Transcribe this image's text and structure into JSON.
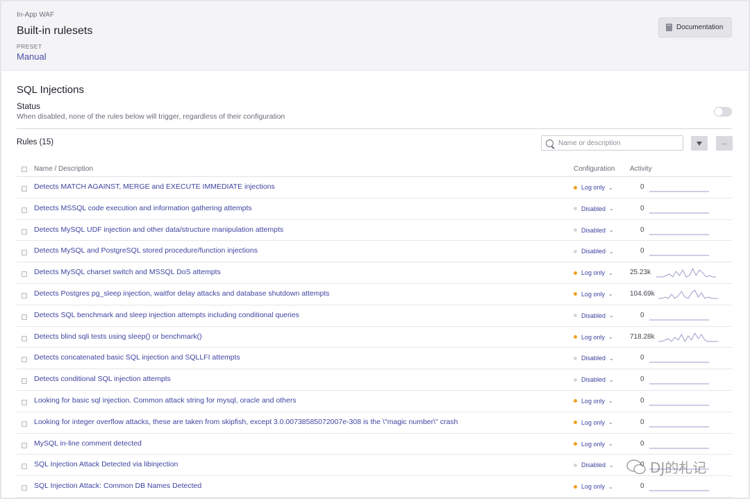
{
  "header": {
    "breadcrumb": "In-App WAF",
    "title": "Built-in rulesets",
    "preset_label": "PRESET",
    "preset_value": "Manual",
    "doc_button": "Documentation"
  },
  "section": {
    "title": "SQL Injections",
    "status_label": "Status",
    "status_desc": "When disabled, none of the rules below will trigger, regardless of their configuration",
    "enabled": false
  },
  "rules": {
    "title": "Rules (15)",
    "search_placeholder": "Name or description",
    "more_label": "···",
    "columns": {
      "name": "Name / Description",
      "config": "Configuration",
      "activity": "Activity"
    },
    "items": [
      {
        "name": "Detects MATCH AGAINST, MERGE and EXECUTE IMMEDIATE injections",
        "config": "Log only",
        "activity": "0"
      },
      {
        "name": "Detects MSSQL code execution and information gathering attempts",
        "config": "Disabled",
        "activity": "0"
      },
      {
        "name": "Detects MySQL UDF injection and other data/structure manipulation attempts",
        "config": "Disabled",
        "activity": "0"
      },
      {
        "name": "Detects MySQL and PostgreSQL stored procedure/function injections",
        "config": "Disabled",
        "activity": "0"
      },
      {
        "name": "Detects MySQL charset switch and MSSQL DoS attempts",
        "config": "Log only",
        "activity": "25.23k"
      },
      {
        "name": "Detects Postgres pg_sleep injection, waitfor delay attacks and database shutdown attempts",
        "config": "Log only",
        "activity": "104.69k"
      },
      {
        "name": "Detects SQL benchmark and sleep injection attempts including conditional queries",
        "config": "Disabled",
        "activity": "0"
      },
      {
        "name": "Detects blind sqli tests using sleep() or benchmark()",
        "config": "Log only",
        "activity": "718.28k"
      },
      {
        "name": "Detects concatenated basic SQL injection and SQLLFI attempts",
        "config": "Disabled",
        "activity": "0"
      },
      {
        "name": "Detects conditional SQL injection attempts",
        "config": "Disabled",
        "activity": "0"
      },
      {
        "name": "Looking for basic sql injection. Common attack string for mysql, oracle and others",
        "config": "Log only",
        "activity": "0"
      },
      {
        "name": "Looking for integer overflow attacks, these are taken from skipfish, except 3.0.00738585072007e-308 is the \\\"magic number\\\" crash",
        "config": "Log only",
        "activity": "0"
      },
      {
        "name": "MySQL in-line comment detected",
        "config": "Log only",
        "activity": "0"
      },
      {
        "name": "SQL Injection Attack Detected via libinjection",
        "config": "Disabled",
        "activity": "0"
      },
      {
        "name": "SQL Injection Attack: Common DB Names Detected",
        "config": "Log only",
        "activity": "0"
      }
    ]
  },
  "colors": {
    "link": "#3f44a0",
    "log_only_dot": "#f0a020",
    "disabled_dot": "#d6d6de",
    "sparkline": "#9a9ec8"
  },
  "watermark": "DJ的札记"
}
